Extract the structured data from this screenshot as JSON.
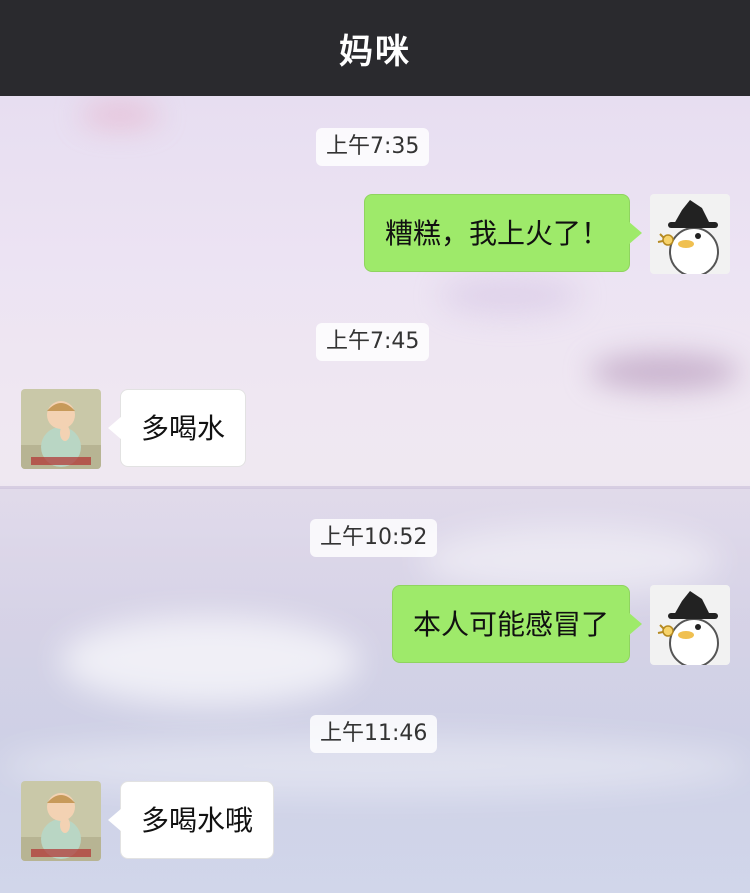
{
  "header": {
    "title": "妈咪"
  },
  "messages": [
    {
      "time": "上午7:35",
      "from": "me",
      "text": "糟糕，我上火了！"
    },
    {
      "time": "上午7:45",
      "from": "mom",
      "text": "多喝水"
    },
    {
      "time": "上午10:52",
      "from": "me",
      "text": "本人可能感冒了"
    },
    {
      "time": "上午11:46",
      "from": "mom",
      "text": "多喝水哦"
    }
  ],
  "colors": {
    "header_bg": "#2a2a2e",
    "outgoing_bubble": "#9eea6a",
    "incoming_bubble": "#ffffff"
  },
  "icons": {
    "my_avatar": "witch-hat-duck-avatar",
    "mom_avatar": "praying-baby-avatar"
  }
}
